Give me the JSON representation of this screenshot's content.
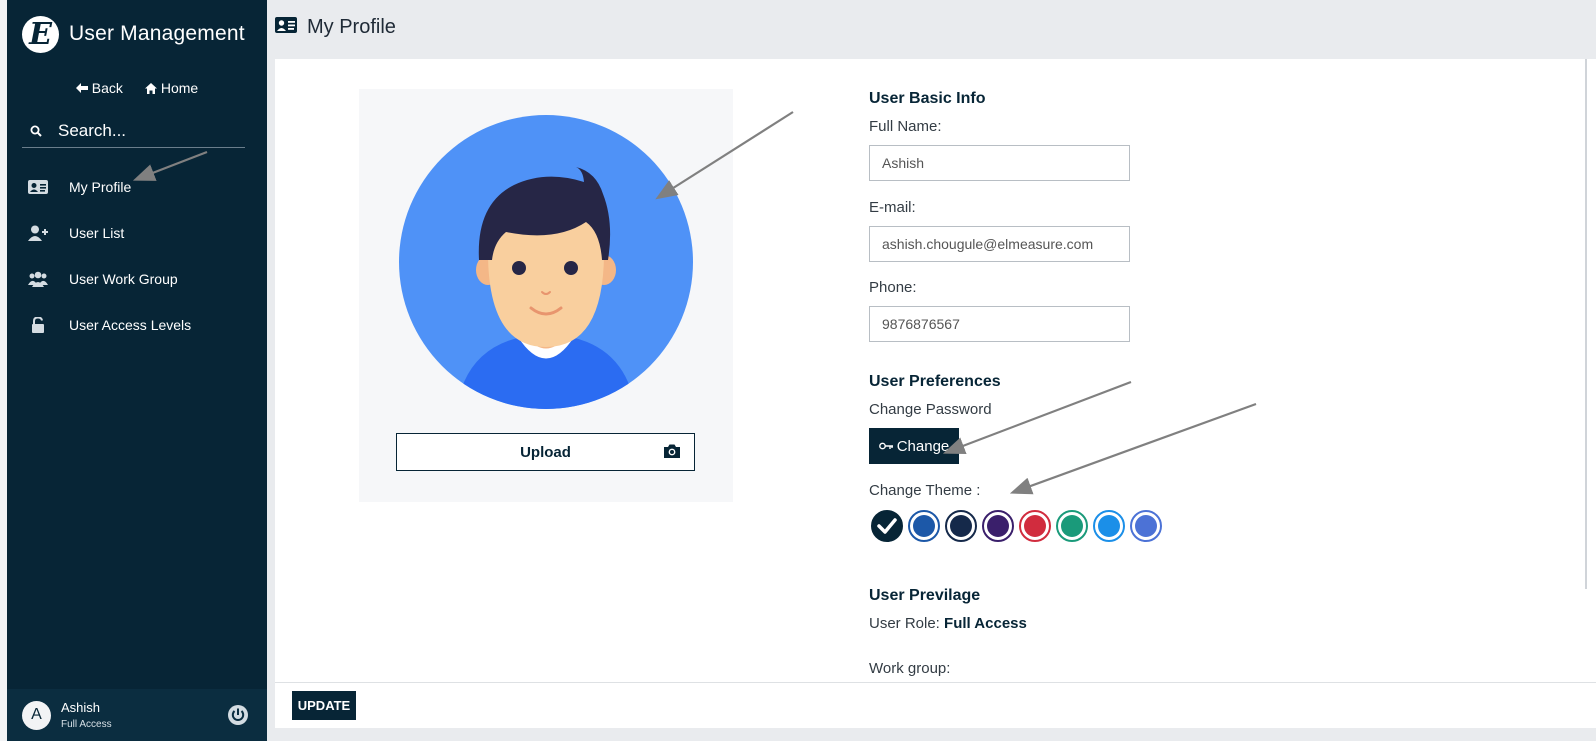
{
  "app": {
    "title": "User Management",
    "logo_letter": "E"
  },
  "nav": {
    "back_label": "Back",
    "home_label": "Home"
  },
  "search": {
    "placeholder": "Search..."
  },
  "menu": [
    {
      "label": "My Profile",
      "icon": "id-card-icon"
    },
    {
      "label": "User List",
      "icon": "user-plus-icon"
    },
    {
      "label": "User Work Group",
      "icon": "users-group-icon"
    },
    {
      "label": "User Access Levels",
      "icon": "unlock-icon"
    }
  ],
  "user": {
    "initial": "A",
    "name": "Ashish",
    "role": "Full Access"
  },
  "header": {
    "title": "My Profile"
  },
  "photo": {
    "upload_label": "Upload"
  },
  "basic_info": {
    "title": "User Basic Info",
    "full_name_label": "Full Name:",
    "full_name": "Ashish",
    "email_label": "E-mail:",
    "email": "ashish.chougule@elmeasure.com",
    "phone_label": "Phone:",
    "phone": "9876876567"
  },
  "preferences": {
    "title": "User Preferences",
    "change_password_label": "Change Password",
    "change_button": "Change",
    "theme_label": "Change Theme :",
    "themes": [
      "#072536",
      "#1c58a8",
      "#15294a",
      "#3a1f6b",
      "#d12c3e",
      "#1a9a7a",
      "#1b8fe8",
      "#4c72d6"
    ],
    "selected_theme_index": 0
  },
  "privilege": {
    "title": "User Previlage",
    "role_label": "User Role:",
    "role_value": "Full Access",
    "workgroup_label": "Work group:"
  },
  "footer": {
    "update_label": "UPDATE"
  }
}
